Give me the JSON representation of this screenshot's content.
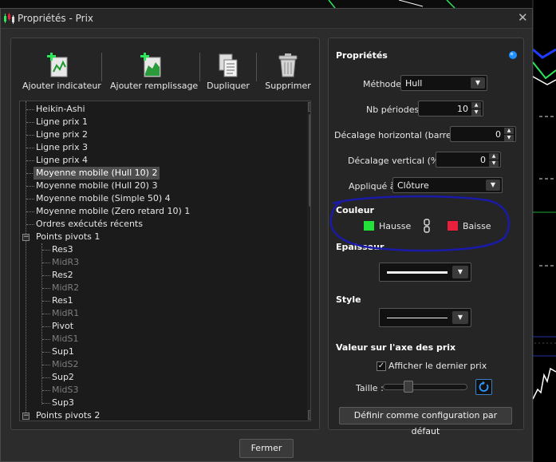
{
  "window": {
    "title": "Propriétés - Prix",
    "close_glyph": "✕"
  },
  "toolbar": {
    "add_indicator": "Ajouter indicateur",
    "add_fill": "Ajouter remplissage",
    "duplicate": "Dupliquer",
    "delete": "Supprimer"
  },
  "tree": {
    "items": [
      "Heikin-Ashi",
      "Ligne prix 1",
      "Ligne prix 2",
      "Ligne prix 3",
      "Ligne prix 4",
      "Moyenne mobile (Hull 10) 2",
      "Moyenne mobile (Hull 20) 3",
      "Moyenne mobile (Simple 50) 4",
      "Moyenne mobile (Zero retard 10) 1",
      "Ordres exécutés récents",
      "Points pivots 1"
    ],
    "children": [
      "Res3",
      "MidR3",
      "Res2",
      "MidR2",
      "Res1",
      "MidR1",
      "Pivot",
      "MidS1",
      "Sup1",
      "MidS2",
      "Sup2",
      "MidS3",
      "Sup3"
    ],
    "last": "Points pivots 2",
    "selected": "Moyenne mobile (Hull 10) 2"
  },
  "props": {
    "heading": "Propriétés",
    "method_label": "Méthode",
    "method_value": "Hull",
    "periods_label": "Nb périodes",
    "periods_value": "10",
    "hshift_label": "Décalage horizontal (barres)",
    "hshift_value": "0",
    "vshift_label": "Décalage vertical (%)",
    "vshift_value": "0",
    "applied_label": "Appliqué à",
    "applied_value": "Clôture",
    "color_heading": "Couleur",
    "up_label": "Hausse",
    "down_label": "Baisse",
    "up_color": "#22e23a",
    "down_color": "#e8203c",
    "thickness_heading": "Epaisseur",
    "style_heading": "Style",
    "axis_heading": "Valeur sur l'axe des prix",
    "show_last_price": "Afficher le dernier prix",
    "size_label": "Taille :",
    "default_button": "Définir comme configuration par défaut"
  },
  "footer": {
    "close_button": "Fermer"
  },
  "colors": {
    "annotation": "#1a1aa8",
    "accent": "#1e90ff"
  }
}
